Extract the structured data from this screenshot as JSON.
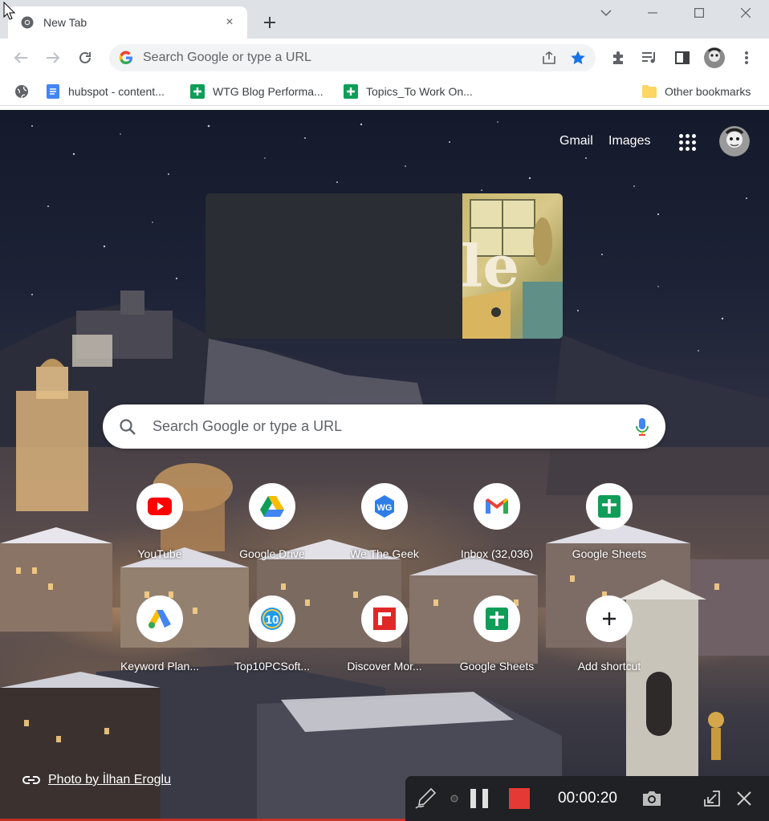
{
  "tab": {
    "title": "New Tab",
    "close_label": "×"
  },
  "toolbar": {
    "omnibox_placeholder": "Search Google or type a URL"
  },
  "bookmarks": [
    {
      "label": "hubspot - content...",
      "icon": "google-docs-icon"
    },
    {
      "label": "WTG Blog Performa...",
      "icon": "google-sheets-icon"
    },
    {
      "label": "Topics_To Work On...",
      "icon": "google-sheets-icon"
    }
  ],
  "other_bookmarks": "Other bookmarks",
  "ntp": {
    "gmail": "Gmail",
    "images": "Images",
    "search_placeholder": "Search Google or type a URL",
    "doodle_letters": "le",
    "shortcuts": [
      {
        "label": "YouTube",
        "icon": "youtube-icon"
      },
      {
        "label": "Google Drive",
        "icon": "google-drive-icon"
      },
      {
        "label": "We The Geek",
        "icon": "we-the-geek-icon"
      },
      {
        "label": "Inbox (32,036)",
        "icon": "gmail-icon"
      },
      {
        "label": "Google Sheets",
        "icon": "google-sheets-icon"
      },
      {
        "label": "Keyword Plan...",
        "icon": "google-ads-icon"
      },
      {
        "label": "Top10PCSoft...",
        "icon": "top10-icon"
      },
      {
        "label": "Discover Mor...",
        "icon": "flipboard-icon"
      },
      {
        "label": "Google Sheets",
        "icon": "google-sheets-icon"
      },
      {
        "label": "Add shortcut",
        "icon": "plus-icon"
      }
    ],
    "photo_credit": "Photo by İlhan Eroglu"
  },
  "recorder": {
    "time": "00:00:20"
  },
  "colors": {
    "accent_blue": "#1a73e8",
    "youtube_red": "#ff0000",
    "sheets_green": "#0f9d58",
    "record_red": "#e53935"
  }
}
